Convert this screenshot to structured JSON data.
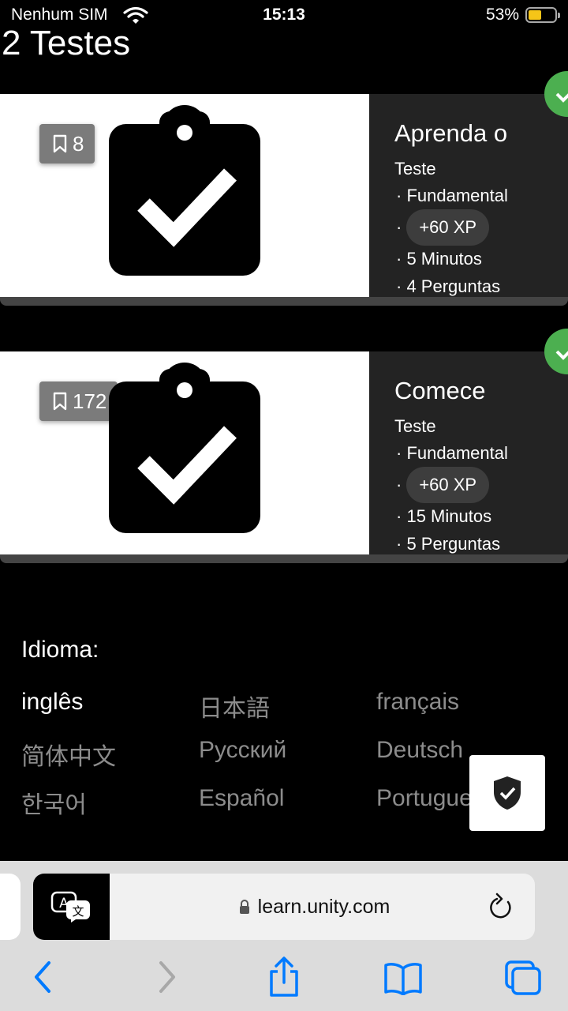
{
  "status_bar": {
    "carrier": "Nenhum SIM",
    "time": "15:13",
    "battery_percent": "53%",
    "battery_level": 0.53
  },
  "page": {
    "heading": "2 Testes"
  },
  "cards": [
    {
      "badge_count": "8",
      "title": "Aprenda o",
      "type": "Teste",
      "level": "Fundamental",
      "xp": "+60 XP",
      "duration": "5 Minutos",
      "questions": "4 Perguntas",
      "completed": true
    },
    {
      "badge_count": "172",
      "title": "Comece",
      "type": "Teste",
      "level": "Fundamental",
      "xp": "+60 XP",
      "duration": "15 Minutos",
      "questions": "5 Perguntas",
      "completed": true
    }
  ],
  "language": {
    "label": "Idioma:",
    "options": [
      "inglês",
      "日本語",
      "français",
      "简体中文",
      "Русский",
      "Deutsch",
      "한국어",
      "Español",
      "Portugue"
    ],
    "selected": "inglês"
  },
  "browser": {
    "url": "learn.unity.com"
  },
  "icons": {
    "bookmark": "bookmark-icon",
    "clipboard": "clipboard-check-icon",
    "check": "checkmark-icon",
    "shield": "shield-check-icon",
    "translate": "translate-icon",
    "lock": "lock-icon",
    "reload": "reload-icon",
    "back": "back-icon",
    "forward": "forward-icon",
    "share": "share-icon",
    "bookmarks": "book-icon",
    "tabs": "tabs-icon"
  },
  "colors": {
    "accent_blue": "#007aff",
    "success_green": "#4caf50",
    "battery_yellow": "#f5c518",
    "card_info_bg": "#232323"
  }
}
